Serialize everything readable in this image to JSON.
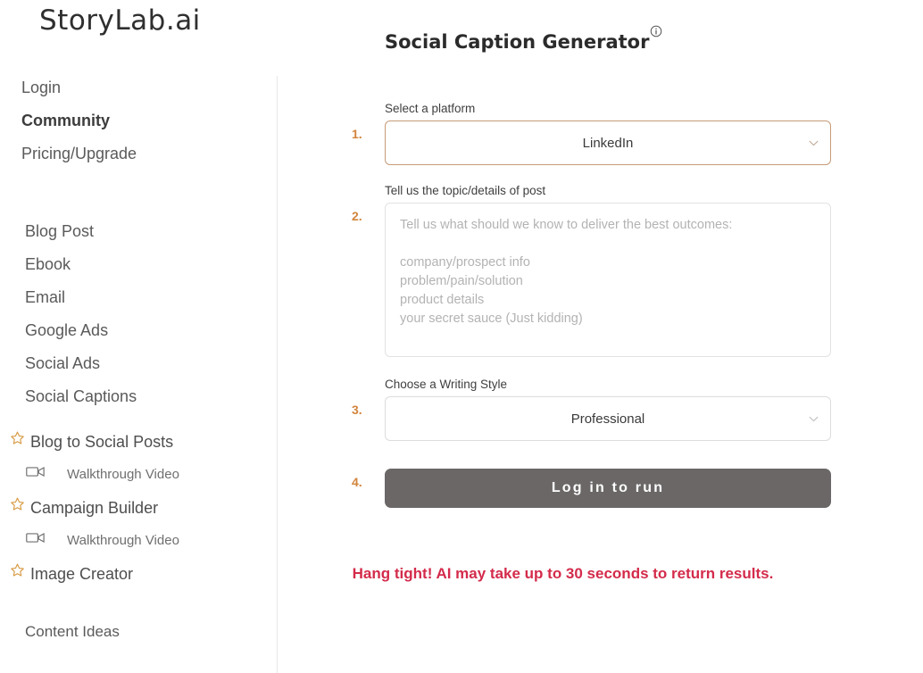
{
  "brand": {
    "logo_text": "StoryLab.ai"
  },
  "sidebar": {
    "account_links": [
      {
        "label": "Login",
        "active": false
      },
      {
        "label": "Community",
        "active": true
      },
      {
        "label": "Pricing/Upgrade",
        "active": false
      }
    ],
    "tools": [
      {
        "label": "Blog Post"
      },
      {
        "label": "Ebook"
      },
      {
        "label": "Email"
      },
      {
        "label": "Google Ads"
      },
      {
        "label": "Social Ads"
      },
      {
        "label": "Social Captions"
      }
    ],
    "starred": [
      {
        "label": "Blog to Social Posts",
        "icon": "star-icon",
        "video": {
          "label": "Walkthrough Video",
          "icon": "video-camera-icon"
        }
      },
      {
        "label": "Campaign Builder",
        "icon": "star-icon",
        "video": {
          "label": "Walkthrough Video",
          "icon": "video-camera-icon"
        }
      },
      {
        "label": "Image Creator",
        "icon": "star-icon",
        "video": null
      }
    ],
    "bottom_links": [
      {
        "label": "Content Ideas"
      }
    ]
  },
  "main": {
    "title": "Social Caption Generator",
    "title_info_icon": "info-circle-icon",
    "steps": {
      "one": "1.",
      "two": "2.",
      "three": "3.",
      "four": "4."
    },
    "platform_field": {
      "label": "Select a platform",
      "value": "LinkedIn",
      "chevron_icon": "chevron-down-icon"
    },
    "topic_field": {
      "label": "Tell us the topic/details of post",
      "placeholder": "Tell us what should we know to deliver the best outcomes:\n\ncompany/prospect info\nproblem/pain/solution\nproduct details\nyour secret sauce (Just kidding)",
      "value": ""
    },
    "style_field": {
      "label": "Choose a Writing Style",
      "value": "Professional",
      "chevron_icon": "chevron-down-icon"
    },
    "submit_button": {
      "label": "Log in to run"
    },
    "notice": "Hang tight! AI may take up to 30 seconds to return results."
  },
  "colors": {
    "accent_orange": "#d2853c",
    "select_border": "#c69b79",
    "button_bg": "#6b6767",
    "notice_red": "#d42b4b",
    "star_gold": "#d79a43"
  }
}
